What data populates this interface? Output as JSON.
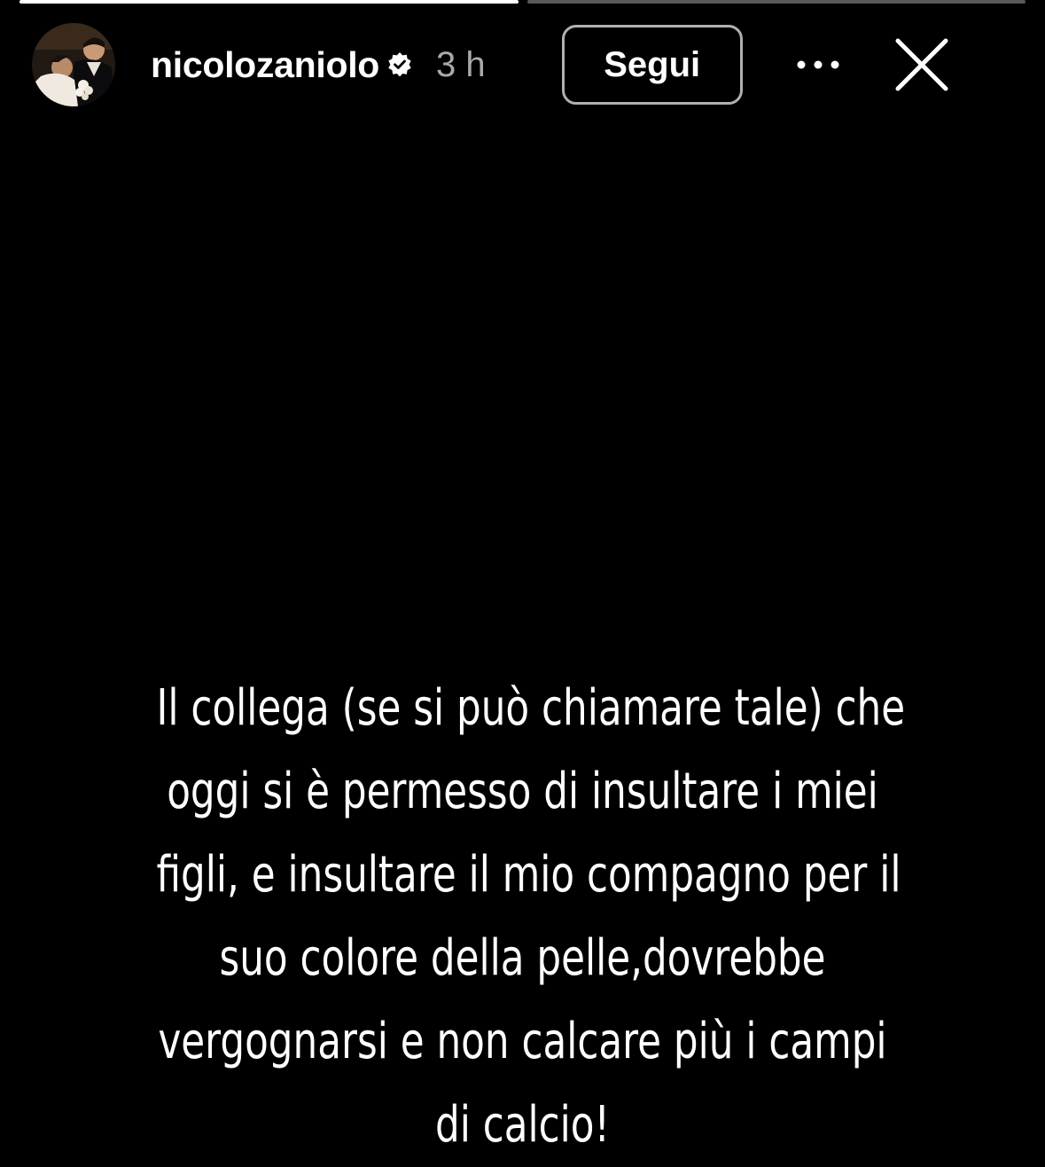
{
  "story": {
    "username": "nicolozaniolo",
    "verified": true,
    "time": "3 h",
    "follow_label": "Segui",
    "text_lines": [
      "Il collega (se si può chiamare tale) che",
      "oggi si è permesso di insultare i miei",
      "figli, e insultare il mio compagno per il",
      "suo colore della pelle,dovrebbe",
      "vergognarsi e non calcare più i campi",
      "di calcio!"
    ],
    "progress": [
      1.0,
      0.0
    ]
  },
  "icons": {
    "verified": "verified-badge-icon",
    "more": "more-options-icon",
    "close": "close-icon"
  },
  "colors": {
    "background": "#000000",
    "text": "#ffffff",
    "muted": "#a9a9a9",
    "button_border": "#b0b0b0"
  }
}
